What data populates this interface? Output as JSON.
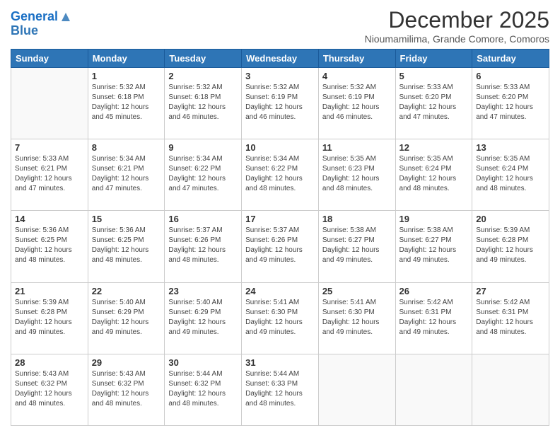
{
  "header": {
    "logo_line1": "General",
    "logo_line2": "Blue",
    "month_title": "December 2025",
    "subtitle": "Nioumamilima, Grande Comore, Comoros"
  },
  "weekdays": [
    "Sunday",
    "Monday",
    "Tuesday",
    "Wednesday",
    "Thursday",
    "Friday",
    "Saturday"
  ],
  "weeks": [
    [
      {
        "day": "",
        "info": ""
      },
      {
        "day": "1",
        "info": "Sunrise: 5:32 AM\nSunset: 6:18 PM\nDaylight: 12 hours\nand 45 minutes."
      },
      {
        "day": "2",
        "info": "Sunrise: 5:32 AM\nSunset: 6:18 PM\nDaylight: 12 hours\nand 46 minutes."
      },
      {
        "day": "3",
        "info": "Sunrise: 5:32 AM\nSunset: 6:19 PM\nDaylight: 12 hours\nand 46 minutes."
      },
      {
        "day": "4",
        "info": "Sunrise: 5:32 AM\nSunset: 6:19 PM\nDaylight: 12 hours\nand 46 minutes."
      },
      {
        "day": "5",
        "info": "Sunrise: 5:33 AM\nSunset: 6:20 PM\nDaylight: 12 hours\nand 47 minutes."
      },
      {
        "day": "6",
        "info": "Sunrise: 5:33 AM\nSunset: 6:20 PM\nDaylight: 12 hours\nand 47 minutes."
      }
    ],
    [
      {
        "day": "7",
        "info": "Sunrise: 5:33 AM\nSunset: 6:21 PM\nDaylight: 12 hours\nand 47 minutes."
      },
      {
        "day": "8",
        "info": "Sunrise: 5:34 AM\nSunset: 6:21 PM\nDaylight: 12 hours\nand 47 minutes."
      },
      {
        "day": "9",
        "info": "Sunrise: 5:34 AM\nSunset: 6:22 PM\nDaylight: 12 hours\nand 47 minutes."
      },
      {
        "day": "10",
        "info": "Sunrise: 5:34 AM\nSunset: 6:22 PM\nDaylight: 12 hours\nand 48 minutes."
      },
      {
        "day": "11",
        "info": "Sunrise: 5:35 AM\nSunset: 6:23 PM\nDaylight: 12 hours\nand 48 minutes."
      },
      {
        "day": "12",
        "info": "Sunrise: 5:35 AM\nSunset: 6:24 PM\nDaylight: 12 hours\nand 48 minutes."
      },
      {
        "day": "13",
        "info": "Sunrise: 5:35 AM\nSunset: 6:24 PM\nDaylight: 12 hours\nand 48 minutes."
      }
    ],
    [
      {
        "day": "14",
        "info": "Sunrise: 5:36 AM\nSunset: 6:25 PM\nDaylight: 12 hours\nand 48 minutes."
      },
      {
        "day": "15",
        "info": "Sunrise: 5:36 AM\nSunset: 6:25 PM\nDaylight: 12 hours\nand 48 minutes."
      },
      {
        "day": "16",
        "info": "Sunrise: 5:37 AM\nSunset: 6:26 PM\nDaylight: 12 hours\nand 48 minutes."
      },
      {
        "day": "17",
        "info": "Sunrise: 5:37 AM\nSunset: 6:26 PM\nDaylight: 12 hours\nand 49 minutes."
      },
      {
        "day": "18",
        "info": "Sunrise: 5:38 AM\nSunset: 6:27 PM\nDaylight: 12 hours\nand 49 minutes."
      },
      {
        "day": "19",
        "info": "Sunrise: 5:38 AM\nSunset: 6:27 PM\nDaylight: 12 hours\nand 49 minutes."
      },
      {
        "day": "20",
        "info": "Sunrise: 5:39 AM\nSunset: 6:28 PM\nDaylight: 12 hours\nand 49 minutes."
      }
    ],
    [
      {
        "day": "21",
        "info": "Sunrise: 5:39 AM\nSunset: 6:28 PM\nDaylight: 12 hours\nand 49 minutes."
      },
      {
        "day": "22",
        "info": "Sunrise: 5:40 AM\nSunset: 6:29 PM\nDaylight: 12 hours\nand 49 minutes."
      },
      {
        "day": "23",
        "info": "Sunrise: 5:40 AM\nSunset: 6:29 PM\nDaylight: 12 hours\nand 49 minutes."
      },
      {
        "day": "24",
        "info": "Sunrise: 5:41 AM\nSunset: 6:30 PM\nDaylight: 12 hours\nand 49 minutes."
      },
      {
        "day": "25",
        "info": "Sunrise: 5:41 AM\nSunset: 6:30 PM\nDaylight: 12 hours\nand 49 minutes."
      },
      {
        "day": "26",
        "info": "Sunrise: 5:42 AM\nSunset: 6:31 PM\nDaylight: 12 hours\nand 49 minutes."
      },
      {
        "day": "27",
        "info": "Sunrise: 5:42 AM\nSunset: 6:31 PM\nDaylight: 12 hours\nand 48 minutes."
      }
    ],
    [
      {
        "day": "28",
        "info": "Sunrise: 5:43 AM\nSunset: 6:32 PM\nDaylight: 12 hours\nand 48 minutes."
      },
      {
        "day": "29",
        "info": "Sunrise: 5:43 AM\nSunset: 6:32 PM\nDaylight: 12 hours\nand 48 minutes."
      },
      {
        "day": "30",
        "info": "Sunrise: 5:44 AM\nSunset: 6:32 PM\nDaylight: 12 hours\nand 48 minutes."
      },
      {
        "day": "31",
        "info": "Sunrise: 5:44 AM\nSunset: 6:33 PM\nDaylight: 12 hours\nand 48 minutes."
      },
      {
        "day": "",
        "info": ""
      },
      {
        "day": "",
        "info": ""
      },
      {
        "day": "",
        "info": ""
      }
    ]
  ]
}
